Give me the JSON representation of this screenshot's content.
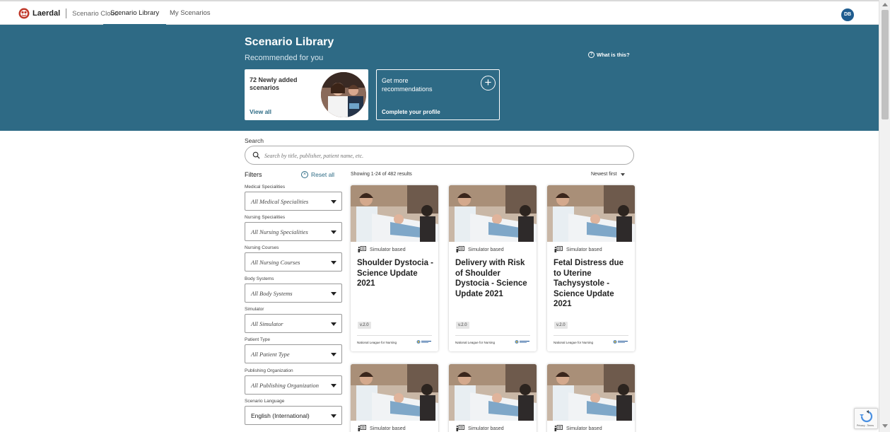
{
  "topbar": {
    "brand": "Laerdal",
    "app_name": "Scenario Cloud",
    "tabs": [
      {
        "label": "Scenario Library",
        "active": true
      },
      {
        "label": "My Scenarios",
        "active": false
      }
    ],
    "avatar_initials": "DB"
  },
  "hero": {
    "title": "Scenario Library",
    "subtitle": "Recommended for you",
    "what_is_this": "What is this?",
    "new_card": {
      "title": "72 Newly added scenarios",
      "link": "View all"
    },
    "profile_card": {
      "title": "Get more recommendations",
      "link": "Complete your profile"
    },
    "background_color": "#2e6a85"
  },
  "search": {
    "label": "Search",
    "placeholder": "Search by title, publisher, patient name, etc.",
    "value": ""
  },
  "filters": {
    "heading": "Filters",
    "reset_label": "Reset all",
    "items": [
      {
        "label": "Medical Specialities",
        "value": "All Medical Specialities",
        "italic": true
      },
      {
        "label": "Nursing Specialities",
        "value": "All Nursing Specialities",
        "italic": true
      },
      {
        "label": "Nursing Courses",
        "value": "All Nursing Courses",
        "italic": true
      },
      {
        "label": "Body Systems",
        "value": "All Body Systems",
        "italic": true
      },
      {
        "label": "Simulator",
        "value": "All Simulator",
        "italic": true
      },
      {
        "label": "Patient Type",
        "value": "All Patient Type",
        "italic": true
      },
      {
        "label": "Publishing Organization",
        "value": "All Publishing Organization",
        "italic": true
      },
      {
        "label": "Scenario Language",
        "value": "English (International)",
        "italic": false
      }
    ]
  },
  "results": {
    "showing": "Showing 1-24 of 482 results",
    "sort": "Newest first",
    "cards": [
      {
        "type": "Simulator based",
        "title": "Shoulder Dystocia - Science Update 2021",
        "version": "v.2.0",
        "publisher": "National League for Nursing"
      },
      {
        "type": "Simulator based",
        "title": "Delivery with Risk of Shoulder Dystocia - Science Update 2021",
        "version": "v.2.0",
        "publisher": "National League for Nursing"
      },
      {
        "type": "Simulator based",
        "title": "Fetal Distress due to Uterine Tachysystole - Science Update 2021",
        "version": "v.2.0",
        "publisher": "National League for Nursing"
      },
      {
        "type": "Simulator based",
        "title": "",
        "version": "",
        "publisher": ""
      },
      {
        "type": "Simulator based",
        "title": "",
        "version": "",
        "publisher": ""
      },
      {
        "type": "Simulator based",
        "title": "",
        "version": "",
        "publisher": ""
      }
    ]
  },
  "recaptcha": {
    "text": "Privacy - Terms"
  },
  "icons": {
    "logo": "laerdal-logo-icon",
    "help": "question-circle-icon",
    "plus": "plus-circle-icon",
    "search": "search-icon",
    "reset": "close-circle-icon",
    "sort": "caret-down-icon",
    "dropdown": "caret-down-icon",
    "simulator": "simulator-icon"
  }
}
